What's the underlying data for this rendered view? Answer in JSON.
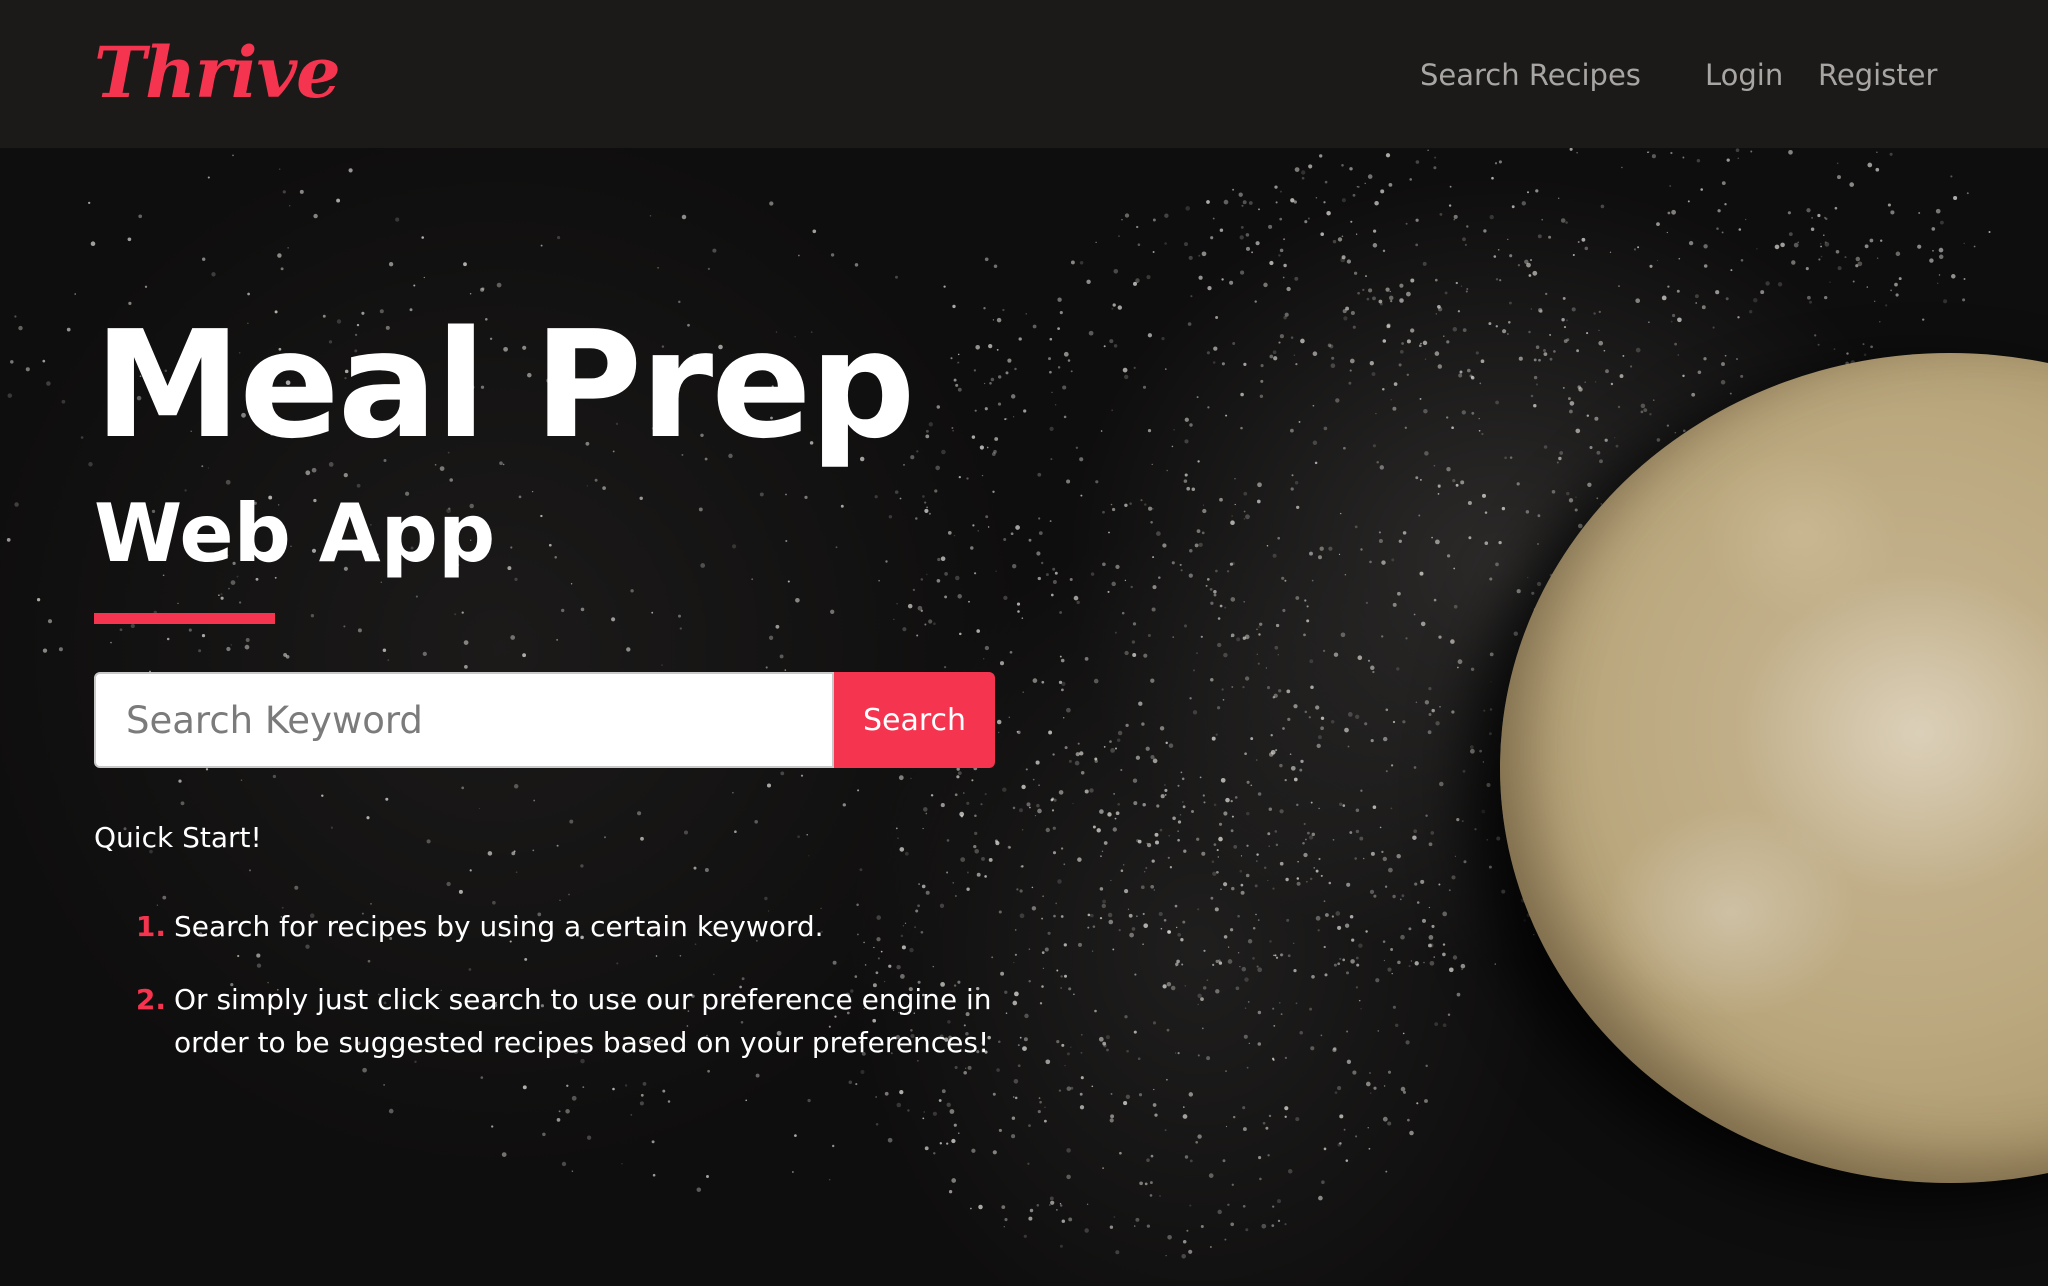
{
  "navbar": {
    "brand": "Thrive",
    "links": {
      "search_recipes": "Search Recipes",
      "login": "Login",
      "register": "Register"
    }
  },
  "hero": {
    "title": "Meal Prep",
    "subtitle": "Web App",
    "search": {
      "placeholder": "Search Keyword",
      "value": "",
      "button_label": "Search"
    },
    "quick_start": {
      "heading": "Quick Start!",
      "steps": [
        {
          "number": "1.",
          "text": "Search for recipes by using a certain keyword."
        },
        {
          "number": "2.",
          "text": "Or simply just click search to use our preference engine in order to be suggested recipes based on your preferences!"
        }
      ]
    }
  },
  "colors": {
    "accent": "#f5344f",
    "navbar_bg": "#1b1a19",
    "nav_link": "#a8a5a2",
    "text": "#ffffff"
  }
}
